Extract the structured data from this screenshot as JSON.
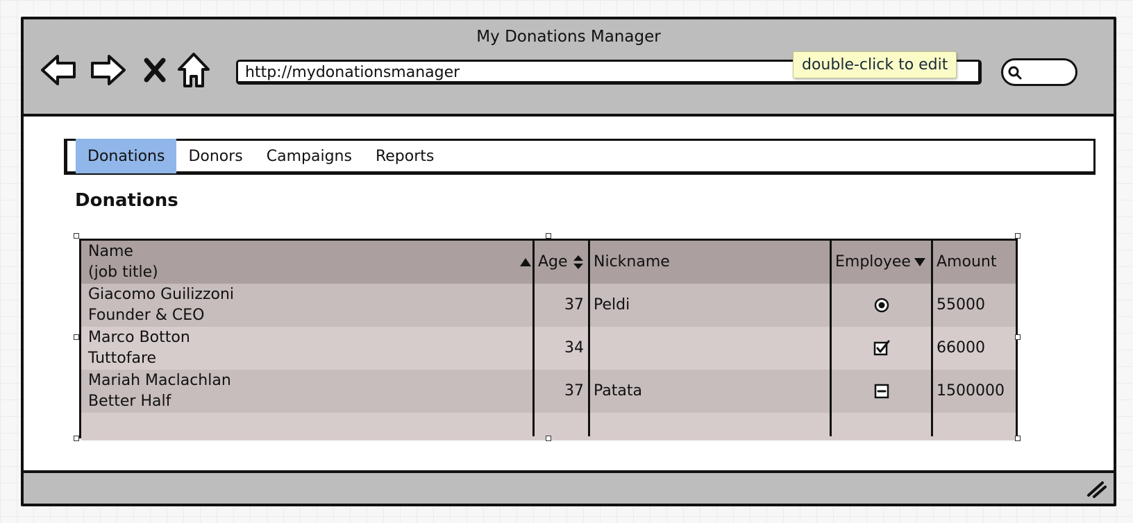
{
  "window": {
    "title": "My Donations Manager"
  },
  "browser": {
    "url": "http://mydonationsmanager",
    "tooltip": "double-click to edit",
    "icons": [
      "back-arrow-icon",
      "forward-arrow-icon",
      "stop-x-icon",
      "home-icon",
      "search-icon",
      "resize-grip-icon"
    ]
  },
  "tabs": [
    {
      "label": "Donations",
      "active": true
    },
    {
      "label": "Donors",
      "active": false
    },
    {
      "label": "Campaigns",
      "active": false
    },
    {
      "label": "Reports",
      "active": false
    }
  ],
  "page": {
    "title": "Donations"
  },
  "table": {
    "headers": {
      "name_line1": "Name",
      "name_line2": "(job title)",
      "age": "Age",
      "nickname": "Nickname",
      "employee": "Employee",
      "amount": "Amount"
    },
    "sort_icons": {
      "name": "sort-ascending-icon",
      "age": "sort-both-icon",
      "employee": "sort-descending-icon"
    },
    "rows": [
      {
        "name": "Giacomo Guilizzoni",
        "title": "Founder & CEO",
        "age": "37",
        "nickname": "Peldi",
        "employee_icon": "radio-selected-icon",
        "amount": "55000"
      },
      {
        "name": "Marco Botton",
        "title": "Tuttofare",
        "age": "34",
        "nickname": "",
        "employee_icon": "checkbox-checked-icon",
        "amount": "66000"
      },
      {
        "name": "Mariah Maclachlan",
        "title": "Better Half",
        "age": "37",
        "nickname": "Patata",
        "employee_icon": "checkbox-indeterminate-icon",
        "amount": "1500000"
      }
    ]
  },
  "colors": {
    "chrome": "#bdbdbd",
    "active_tab": "#91b6e9",
    "table_header": "#aba09f",
    "row_odd": "#c7bdbc",
    "row_even": "#d7cccc",
    "tooltip": "#fbfbc8"
  }
}
